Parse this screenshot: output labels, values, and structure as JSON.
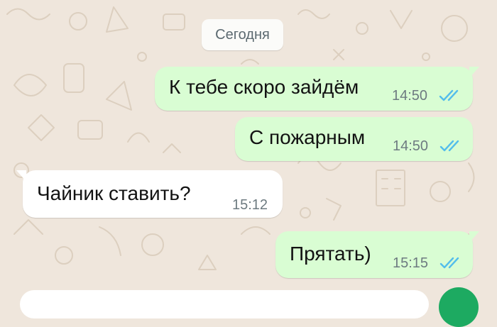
{
  "date_divider": "Сегодня",
  "messages": [
    {
      "direction": "outgoing",
      "text": "К тебе скоро зайдём",
      "time": "14:50",
      "status": "read"
    },
    {
      "direction": "outgoing",
      "text": "С пожарным",
      "time": "14:50",
      "status": "read"
    },
    {
      "direction": "incoming",
      "text": "Чайник ставить?",
      "time": "15:12"
    },
    {
      "direction": "outgoing",
      "text": "Прятать)",
      "time": "15:15",
      "status": "read"
    }
  ],
  "colors": {
    "wallpaper": "#efe6dc",
    "outgoing_bubble": "#d9fdd3",
    "incoming_bubble": "#ffffff",
    "read_ticks": "#53bdeb",
    "send_button": "#1daa61"
  },
  "icons": {
    "read_status": "double-check-icon"
  }
}
